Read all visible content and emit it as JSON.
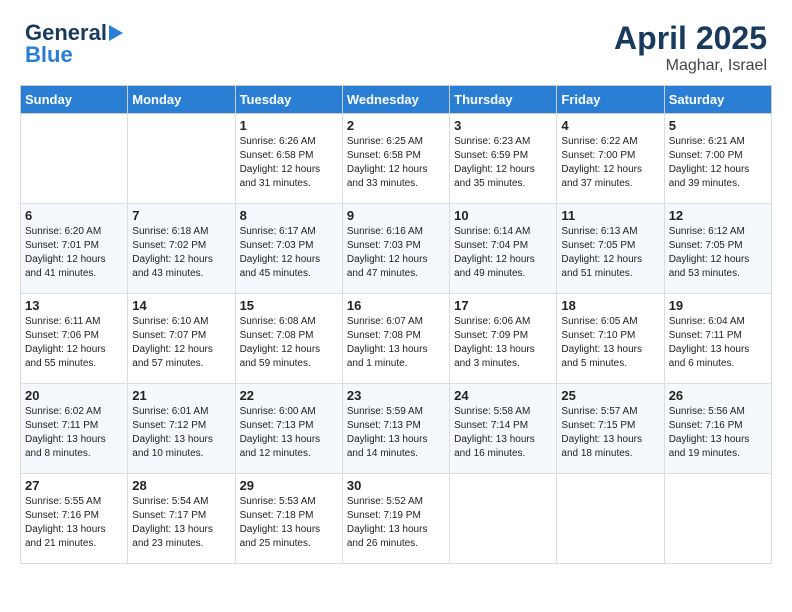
{
  "header": {
    "logo_line1": "General",
    "logo_line2": "Blue",
    "title": "April 2025",
    "subtitle": "Maghar, Israel"
  },
  "days_of_week": [
    "Sunday",
    "Monday",
    "Tuesday",
    "Wednesday",
    "Thursday",
    "Friday",
    "Saturday"
  ],
  "weeks": [
    [
      {
        "day": "",
        "info": ""
      },
      {
        "day": "",
        "info": ""
      },
      {
        "day": "1",
        "info": "Sunrise: 6:26 AM\nSunset: 6:58 PM\nDaylight: 12 hours\nand 31 minutes."
      },
      {
        "day": "2",
        "info": "Sunrise: 6:25 AM\nSunset: 6:58 PM\nDaylight: 12 hours\nand 33 minutes."
      },
      {
        "day": "3",
        "info": "Sunrise: 6:23 AM\nSunset: 6:59 PM\nDaylight: 12 hours\nand 35 minutes."
      },
      {
        "day": "4",
        "info": "Sunrise: 6:22 AM\nSunset: 7:00 PM\nDaylight: 12 hours\nand 37 minutes."
      },
      {
        "day": "5",
        "info": "Sunrise: 6:21 AM\nSunset: 7:00 PM\nDaylight: 12 hours\nand 39 minutes."
      }
    ],
    [
      {
        "day": "6",
        "info": "Sunrise: 6:20 AM\nSunset: 7:01 PM\nDaylight: 12 hours\nand 41 minutes."
      },
      {
        "day": "7",
        "info": "Sunrise: 6:18 AM\nSunset: 7:02 PM\nDaylight: 12 hours\nand 43 minutes."
      },
      {
        "day": "8",
        "info": "Sunrise: 6:17 AM\nSunset: 7:03 PM\nDaylight: 12 hours\nand 45 minutes."
      },
      {
        "day": "9",
        "info": "Sunrise: 6:16 AM\nSunset: 7:03 PM\nDaylight: 12 hours\nand 47 minutes."
      },
      {
        "day": "10",
        "info": "Sunrise: 6:14 AM\nSunset: 7:04 PM\nDaylight: 12 hours\nand 49 minutes."
      },
      {
        "day": "11",
        "info": "Sunrise: 6:13 AM\nSunset: 7:05 PM\nDaylight: 12 hours\nand 51 minutes."
      },
      {
        "day": "12",
        "info": "Sunrise: 6:12 AM\nSunset: 7:05 PM\nDaylight: 12 hours\nand 53 minutes."
      }
    ],
    [
      {
        "day": "13",
        "info": "Sunrise: 6:11 AM\nSunset: 7:06 PM\nDaylight: 12 hours\nand 55 minutes."
      },
      {
        "day": "14",
        "info": "Sunrise: 6:10 AM\nSunset: 7:07 PM\nDaylight: 12 hours\nand 57 minutes."
      },
      {
        "day": "15",
        "info": "Sunrise: 6:08 AM\nSunset: 7:08 PM\nDaylight: 12 hours\nand 59 minutes."
      },
      {
        "day": "16",
        "info": "Sunrise: 6:07 AM\nSunset: 7:08 PM\nDaylight: 13 hours\nand 1 minute."
      },
      {
        "day": "17",
        "info": "Sunrise: 6:06 AM\nSunset: 7:09 PM\nDaylight: 13 hours\nand 3 minutes."
      },
      {
        "day": "18",
        "info": "Sunrise: 6:05 AM\nSunset: 7:10 PM\nDaylight: 13 hours\nand 5 minutes."
      },
      {
        "day": "19",
        "info": "Sunrise: 6:04 AM\nSunset: 7:11 PM\nDaylight: 13 hours\nand 6 minutes."
      }
    ],
    [
      {
        "day": "20",
        "info": "Sunrise: 6:02 AM\nSunset: 7:11 PM\nDaylight: 13 hours\nand 8 minutes."
      },
      {
        "day": "21",
        "info": "Sunrise: 6:01 AM\nSunset: 7:12 PM\nDaylight: 13 hours\nand 10 minutes."
      },
      {
        "day": "22",
        "info": "Sunrise: 6:00 AM\nSunset: 7:13 PM\nDaylight: 13 hours\nand 12 minutes."
      },
      {
        "day": "23",
        "info": "Sunrise: 5:59 AM\nSunset: 7:13 PM\nDaylight: 13 hours\nand 14 minutes."
      },
      {
        "day": "24",
        "info": "Sunrise: 5:58 AM\nSunset: 7:14 PM\nDaylight: 13 hours\nand 16 minutes."
      },
      {
        "day": "25",
        "info": "Sunrise: 5:57 AM\nSunset: 7:15 PM\nDaylight: 13 hours\nand 18 minutes."
      },
      {
        "day": "26",
        "info": "Sunrise: 5:56 AM\nSunset: 7:16 PM\nDaylight: 13 hours\nand 19 minutes."
      }
    ],
    [
      {
        "day": "27",
        "info": "Sunrise: 5:55 AM\nSunset: 7:16 PM\nDaylight: 13 hours\nand 21 minutes."
      },
      {
        "day": "28",
        "info": "Sunrise: 5:54 AM\nSunset: 7:17 PM\nDaylight: 13 hours\nand 23 minutes."
      },
      {
        "day": "29",
        "info": "Sunrise: 5:53 AM\nSunset: 7:18 PM\nDaylight: 13 hours\nand 25 minutes."
      },
      {
        "day": "30",
        "info": "Sunrise: 5:52 AM\nSunset: 7:19 PM\nDaylight: 13 hours\nand 26 minutes."
      },
      {
        "day": "",
        "info": ""
      },
      {
        "day": "",
        "info": ""
      },
      {
        "day": "",
        "info": ""
      }
    ]
  ]
}
